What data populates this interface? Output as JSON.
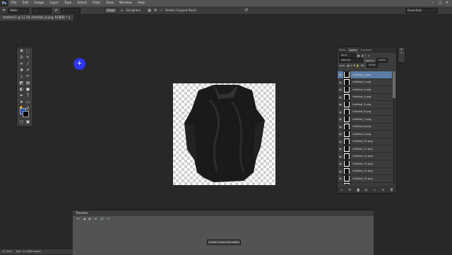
{
  "app": {
    "logo": "Ps"
  },
  "menu": [
    "File",
    "Edit",
    "Image",
    "Layer",
    "Type",
    "Select",
    "Filter",
    "View",
    "Window",
    "Help"
  ],
  "window_controls": [
    "–",
    "□",
    "✕"
  ],
  "options_bar": {
    "ratio_value": "Ratio",
    "field_value": "...",
    "clear_label": "Clear",
    "straighten_label": "Straighten",
    "delete_cropped_label": "Delete Cropped Pixels",
    "workspace": "Essentials"
  },
  "document_tab": "Untitled-1 @ 11.2% (Untitled_6.png, RGB/8) *",
  "toolbox": {
    "fg_color": "#1f4fbf",
    "bg_color": "#000000"
  },
  "layers_panel": {
    "tabs": [
      "Paths",
      "Layers",
      "Channels"
    ],
    "kind_filter": "Kind",
    "blend_mode": "Normal",
    "opacity_label": "Opacity:",
    "opacity_value": "100%",
    "lock_label": "Lock:",
    "fill_label": "Fill:",
    "fill_value": "100%",
    "layers": [
      "Untitled_1.png",
      "Untitled_2.png",
      "Untitled_3.png",
      "Untitled_4.png",
      "Untitled_5.png",
      "Untitled_6.png",
      "Untitled_7.png",
      "Untitled_8.png",
      "Untitled_9.png",
      "Untitled_10.png",
      "Untitled_11.png",
      "Untitled_12.png",
      "Untitled_13.png",
      "Untitled_14.png",
      "Untitled_15.png",
      "Untitled_16.png"
    ],
    "footer_icons": [
      "link-icon",
      "fx-icon",
      "mask-icon",
      "adjustment-icon",
      "folder-icon",
      "new-layer-icon",
      "trash-icon"
    ]
  },
  "timeline": {
    "title": "Timeline",
    "controls": [
      "⏮",
      "◀",
      "▶",
      "⏭",
      "🔊",
      "✂"
    ],
    "create_button": "Create Frame Animation"
  },
  "statusbar": {
    "zoom": "11.25%",
    "doc_info": "Doc: 11.4M/0 bytes"
  }
}
